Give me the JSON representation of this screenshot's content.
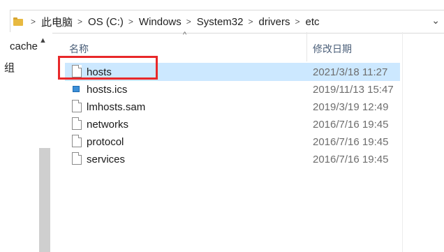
{
  "address_bar": {
    "path": [
      "此电脑",
      "OS (C:)",
      "Windows",
      "System32",
      "drivers",
      "etc"
    ]
  },
  "nav": {
    "items": [
      "cache",
      "组"
    ]
  },
  "columns": {
    "name": "名称",
    "date_modified": "修改日期"
  },
  "files": [
    {
      "name": "hosts",
      "date": "2021/3/18 11:27",
      "icon": "file-icon",
      "selected": true
    },
    {
      "name": "hosts.ics",
      "date": "2019/11/13 15:47",
      "icon": "ics-file-icon",
      "selected": false
    },
    {
      "name": "lmhosts.sam",
      "date": "2019/3/19 12:49",
      "icon": "file-icon",
      "selected": false
    },
    {
      "name": "networks",
      "date": "2016/7/16 19:45",
      "icon": "file-icon",
      "selected": false
    },
    {
      "name": "protocol",
      "date": "2016/7/16 19:45",
      "icon": "file-icon",
      "selected": false
    },
    {
      "name": "services",
      "date": "2016/7/16 19:45",
      "icon": "file-icon",
      "selected": false
    }
  ],
  "colors": {
    "selection": "#cce8ff",
    "highlight_box": "#e8282a",
    "folder": "#e8b940"
  }
}
